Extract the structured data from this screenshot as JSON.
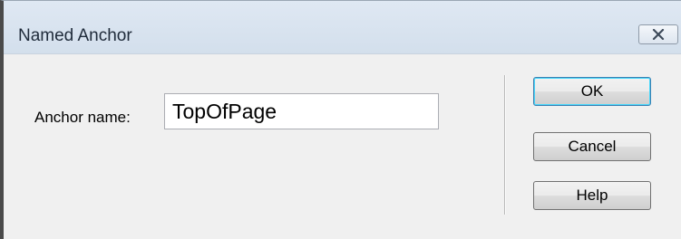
{
  "dialog": {
    "title": "Named Anchor",
    "close_icon": "close-icon"
  },
  "form": {
    "anchor_label": "Anchor name:",
    "anchor_value": "TopOfPage"
  },
  "buttons": {
    "ok": "OK",
    "cancel": "Cancel",
    "help": "Help"
  },
  "colors": {
    "titlebar": "#d3dfec",
    "client": "#f0f0f0",
    "default_button_border": "#3c7fb1"
  }
}
